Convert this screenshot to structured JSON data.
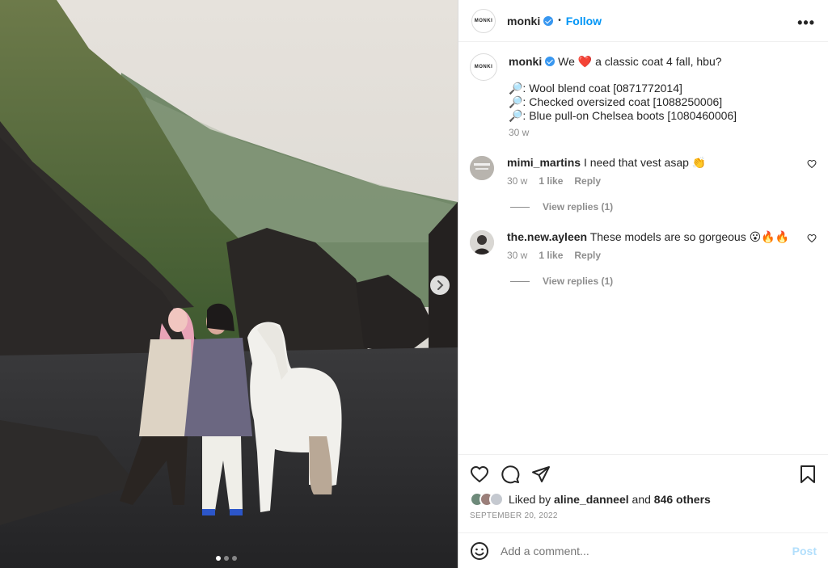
{
  "post": {
    "username": "monki",
    "avatar_text": "MONKI",
    "follow_label": "Follow",
    "separator": "•",
    "more_label": "•••"
  },
  "caption": {
    "username": "monki",
    "text_before_heart": "We",
    "heart": "❤️",
    "text_after_heart": "a classic coat 4 fall, hbu?",
    "lines": [
      "🔎: Wool blend coat [0871772014]",
      "🔎: Checked oversized coat [1088250006]",
      "🔎: Blue pull-on Chelsea boots [1080460006]"
    ],
    "time": "30 w"
  },
  "comments": [
    {
      "username": "mimi_martins",
      "text": "I need that vest asap 👏",
      "time": "30 w",
      "likes": "1 like",
      "reply_label": "Reply",
      "view_replies": "View replies (1)"
    },
    {
      "username": "the.new.ayleen",
      "text": "These models are so gorgeous 😮🔥🔥",
      "time": "30 w",
      "likes": "1 like",
      "reply_label": "Reply",
      "view_replies": "View replies (1)"
    }
  ],
  "likes": {
    "prefix": "Liked by",
    "user": "aline_danneel",
    "middle": "and",
    "others": "846 others"
  },
  "date": "SEPTEMBER 20, 2022",
  "add_comment": {
    "placeholder": "Add a comment...",
    "post_label": "Post"
  },
  "colors": {
    "accent": "#0095f6",
    "post_disabled": "#b2dffc",
    "verified": "#3897f0",
    "secondary_text": "#8e8e8e"
  },
  "icons": [
    "chevron-right-icon",
    "heart-icon",
    "comment-icon",
    "share-icon",
    "bookmark-icon",
    "emoji-icon",
    "verified-icon",
    "more-icon"
  ],
  "carousel": {
    "current": 1,
    "total": 3
  }
}
